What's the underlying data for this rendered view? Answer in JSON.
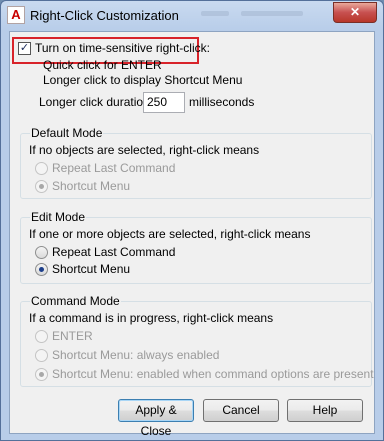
{
  "window": {
    "title": "Right-Click Customization",
    "app_icon": "autocad-a-icon",
    "close_glyph": "✕"
  },
  "time_sensitive": {
    "checkbox_label": "Turn on time-sensitive right-click:",
    "checked": true,
    "line1": "Quick click for ENTER",
    "line2": "Longer click to display Shortcut Menu",
    "duration_label": "Longer click duration:",
    "duration_value": "250",
    "duration_unit": "milliseconds"
  },
  "default_mode": {
    "title": "Default Mode",
    "desc": "If no objects are selected, right-click means",
    "options": [
      "Repeat Last Command",
      "Shortcut Menu"
    ],
    "selected": 1,
    "enabled": false
  },
  "edit_mode": {
    "title": "Edit Mode",
    "desc": "If one or more objects are selected, right-click means",
    "options": [
      "Repeat Last Command",
      "Shortcut Menu"
    ],
    "selected": 1,
    "enabled": true
  },
  "command_mode": {
    "title": "Command Mode",
    "desc": "If a command is in progress, right-click means",
    "options": [
      "ENTER",
      "Shortcut Menu: always enabled",
      "Shortcut Menu: enabled when command options are present"
    ],
    "selected": 2,
    "enabled": false
  },
  "buttons": {
    "apply_close": "Apply & Close",
    "cancel": "Cancel",
    "help": "Help"
  },
  "colors": {
    "highlight_border": "#d8232a",
    "titlebar": "#b8cde9",
    "close_button": "#c75050"
  }
}
